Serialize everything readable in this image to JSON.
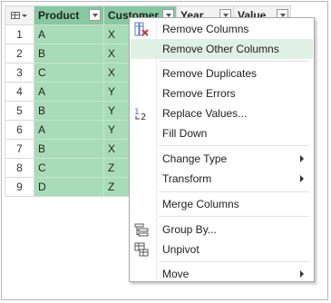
{
  "columns": [
    {
      "name": "Product",
      "selected": true
    },
    {
      "name": "Customer",
      "selected": true
    },
    {
      "name": "Year",
      "selected": false
    },
    {
      "name": "Value",
      "selected": false
    }
  ],
  "rows": [
    {
      "n": "1",
      "product": "A",
      "customer": "X"
    },
    {
      "n": "2",
      "product": "B",
      "customer": "X"
    },
    {
      "n": "3",
      "product": "C",
      "customer": "X"
    },
    {
      "n": "4",
      "product": "A",
      "customer": "Y"
    },
    {
      "n": "5",
      "product": "B",
      "customer": "Y"
    },
    {
      "n": "6",
      "product": "A",
      "customer": "Y"
    },
    {
      "n": "7",
      "product": "B",
      "customer": "X"
    },
    {
      "n": "8",
      "product": "C",
      "customer": "Z"
    },
    {
      "n": "9",
      "product": "D",
      "customer": "Z"
    }
  ],
  "menu": {
    "remove_columns": "Remove Columns",
    "remove_other_columns": "Remove Other Columns",
    "remove_duplicates": "Remove Duplicates",
    "remove_errors": "Remove Errors",
    "replace_values": "Replace Values...",
    "fill_down": "Fill Down",
    "change_type": "Change Type",
    "transform": "Transform",
    "merge_columns": "Merge Columns",
    "group_by": "Group By...",
    "unpivot": "Unpivot",
    "move": "Move",
    "highlighted_item": "remove_other_columns"
  },
  "icons": {
    "table_menu": "table-icon",
    "remove_columns": "remove-columns-icon",
    "replace_values": "replace-values-icon",
    "group_by": "group-by-icon",
    "unpivot": "unpivot-icon"
  },
  "colors": {
    "selected_header": "#86c9a0",
    "selected_cell": "#a8dcb9",
    "menu_highlight": "#dff0e4"
  }
}
